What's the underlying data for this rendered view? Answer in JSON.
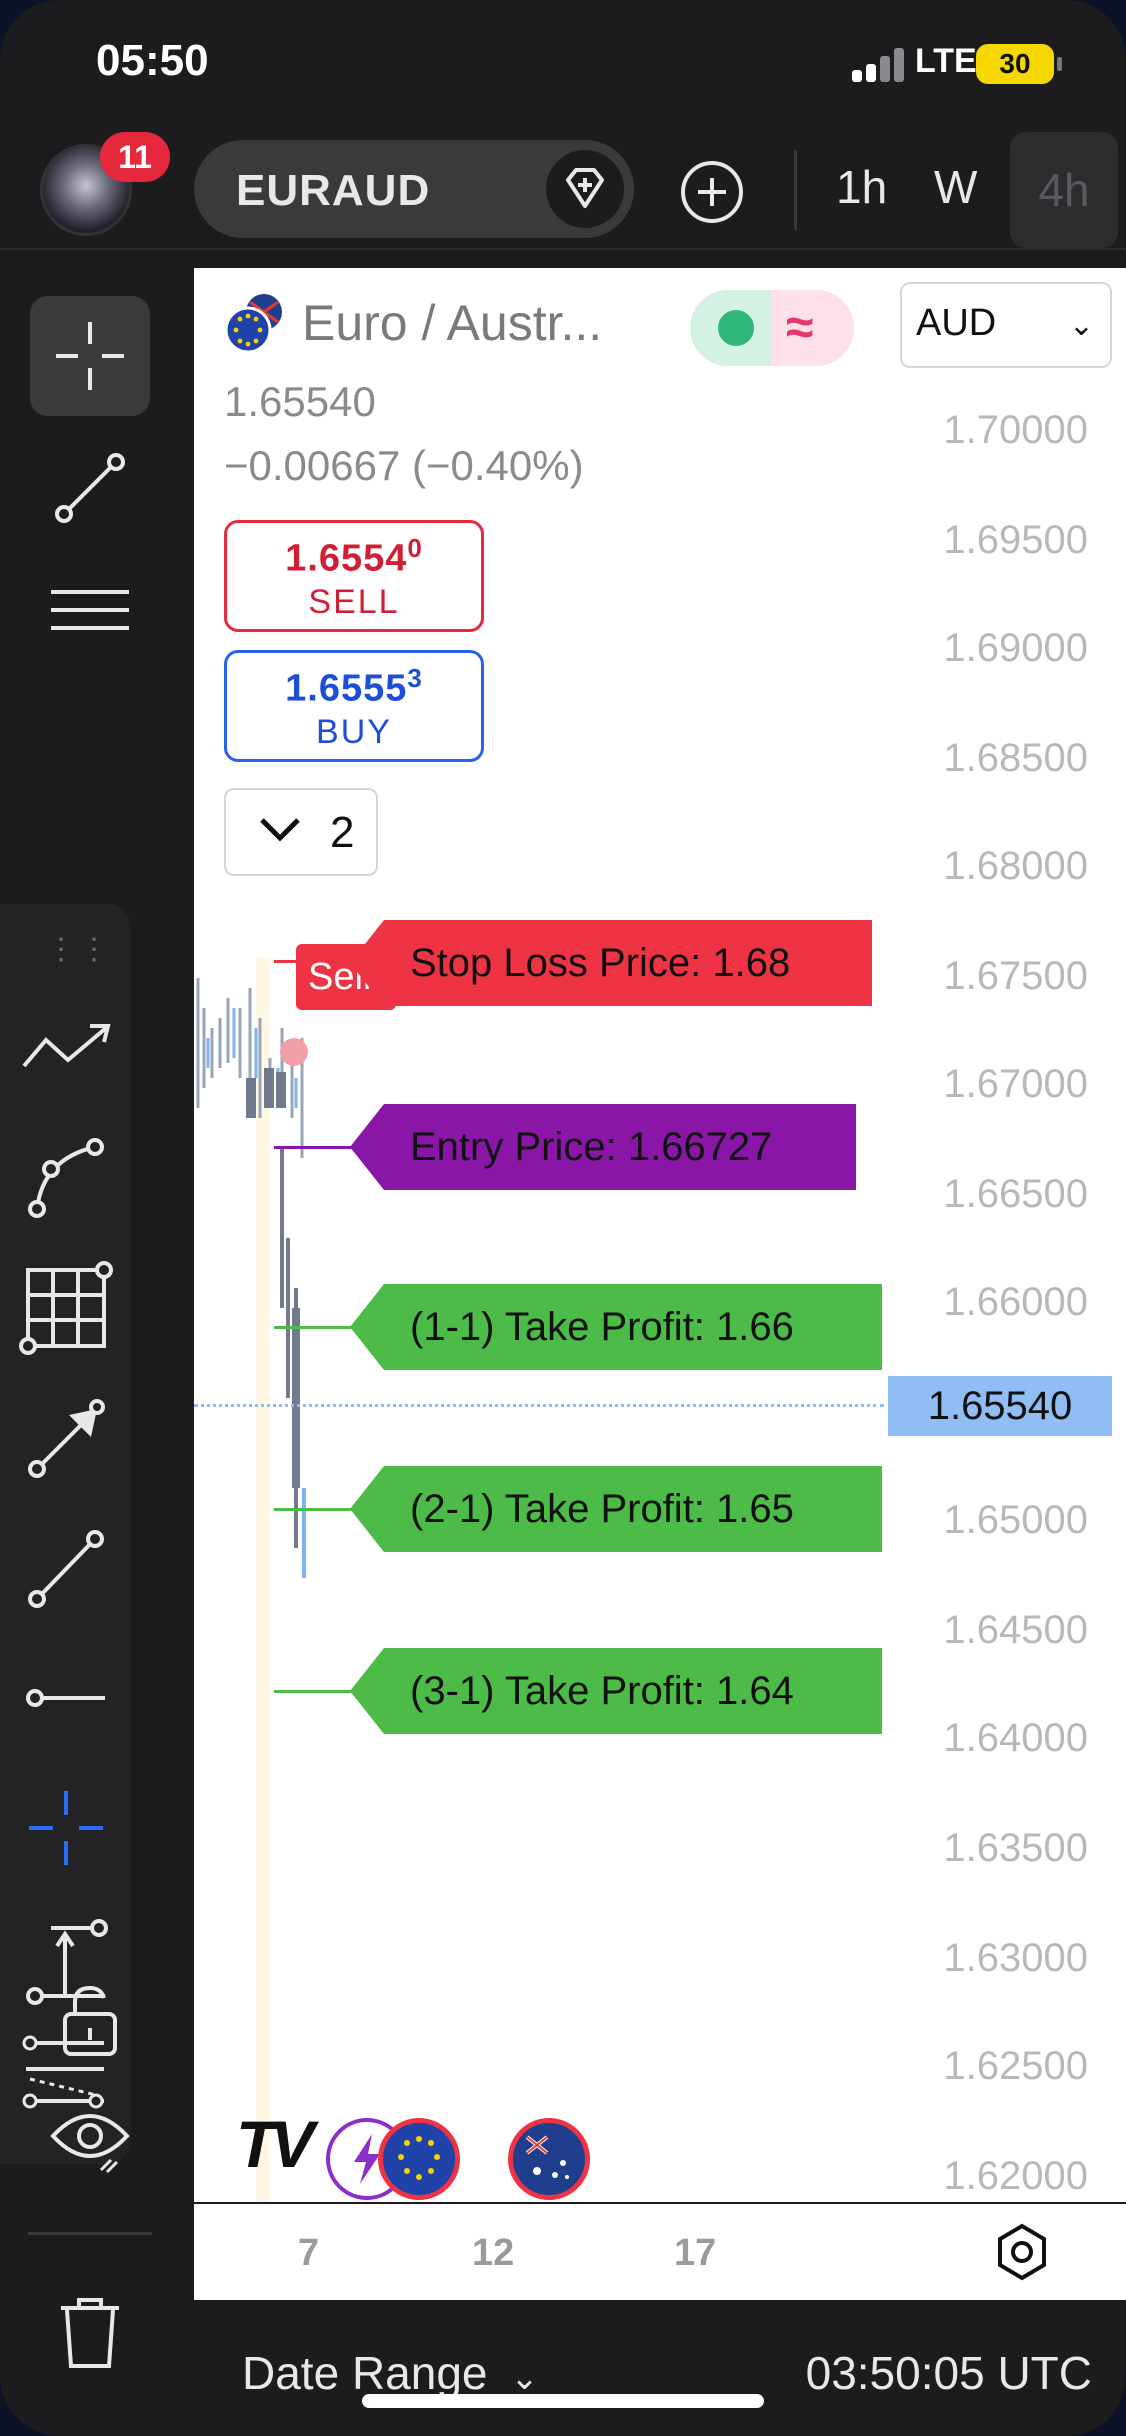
{
  "status_bar": {
    "time": "05:50",
    "network": "LTE",
    "battery": "30"
  },
  "header": {
    "notification_count": "11",
    "symbol": "EURAUD",
    "timeframes": [
      "1h",
      "W"
    ],
    "active_timeframe": "4h"
  },
  "chart": {
    "title": "Euro / Austr...",
    "currency": "AUD",
    "last_price": "1.65540",
    "change": "−0.00667 (−0.40%)",
    "sell": {
      "price": "1.6554",
      "price_sup": "0",
      "label": "SELL"
    },
    "buy": {
      "price": "1.6555",
      "price_sup": "3",
      "label": "BUY"
    },
    "indicators_count": "2",
    "sell_tag": "Sell",
    "current_price_label": "1.65540",
    "levels": {
      "stop_loss": "Stop Loss Price: 1.68",
      "entry": "Entry Price: 1.66727",
      "tp1": "(1-1) Take Profit: 1.66",
      "tp2": "(2-1) Take Profit: 1.65",
      "tp3": "(3-1) Take Profit: 1.64"
    },
    "price_axis": [
      "1.70000",
      "1.69500",
      "1.69000",
      "1.68500",
      "1.68000",
      "1.67500",
      "1.67000",
      "1.66500",
      "1.66000",
      "1.65000",
      "1.64500",
      "1.64000",
      "1.63500",
      "1.63000",
      "1.62500",
      "1.62000"
    ],
    "time_axis": [
      "7",
      "12",
      "17"
    ],
    "logo": "TV"
  },
  "footer": {
    "date_range": "Date Range",
    "clock": "03:50:05 UTC"
  },
  "colors": {
    "stop_loss": "#ee3345",
    "entry": "#8a16a8",
    "take_profit": "#4cbb47",
    "sell": "#d01f35",
    "buy": "#1d4ed8",
    "current_price": "#90bdf4"
  }
}
